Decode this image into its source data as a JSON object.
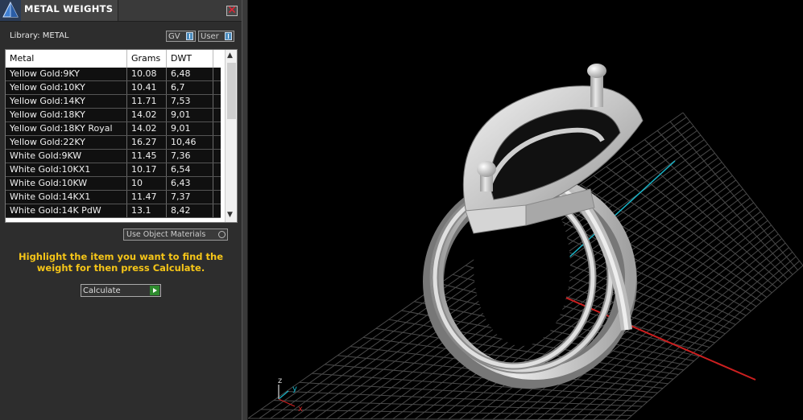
{
  "window": {
    "title": "METAL WEIGHTS",
    "close_glyph": "✕"
  },
  "library": {
    "label": "Library: METAL"
  },
  "toggles": [
    {
      "label": "GV"
    },
    {
      "label": "User"
    }
  ],
  "table": {
    "columns": [
      "Metal",
      "Grams",
      "DWT"
    ],
    "rows": [
      [
        "Yellow Gold:9KY",
        "10.08",
        "6,48"
      ],
      [
        "Yellow Gold:10KY",
        "10.41",
        "6,7"
      ],
      [
        "Yellow Gold:14KY",
        "11.71",
        "7,53"
      ],
      [
        "Yellow Gold:18KY",
        "14.02",
        "9,01"
      ],
      [
        "Yellow Gold:18KY Royal",
        "14.02",
        "9,01"
      ],
      [
        "Yellow Gold:22KY",
        "16.27",
        "10,46"
      ],
      [
        "White Gold:9KW",
        "11.45",
        "7,36"
      ],
      [
        "White Gold:10KX1",
        "10.17",
        "6,54"
      ],
      [
        "White Gold:10KW",
        "10",
        "6,43"
      ],
      [
        "White Gold:14KX1",
        "11.47",
        "7,37"
      ],
      [
        "White Gold:14K PdW",
        "13.1",
        "8,42"
      ]
    ]
  },
  "use_object_materials": {
    "label": "Use Object Materials"
  },
  "hint": {
    "text": "Highlight the item you want to find the weight for then press Calculate."
  },
  "calculate": {
    "label": "Calculate"
  },
  "axes_gizmo": {
    "x": "x",
    "y": "y",
    "z": "z"
  },
  "colors": {
    "accent_text": "#f5c518",
    "x_axis": "#cc1f1f",
    "y_axis": "#19b5c9",
    "z_axis": "#d8d8d8"
  },
  "icons": {
    "logo": "pyramid-logo-icon",
    "close": "close-icon",
    "toggle_indicator": "toggle-indicator-icon",
    "radio": "radio-icon",
    "play": "play-icon"
  }
}
